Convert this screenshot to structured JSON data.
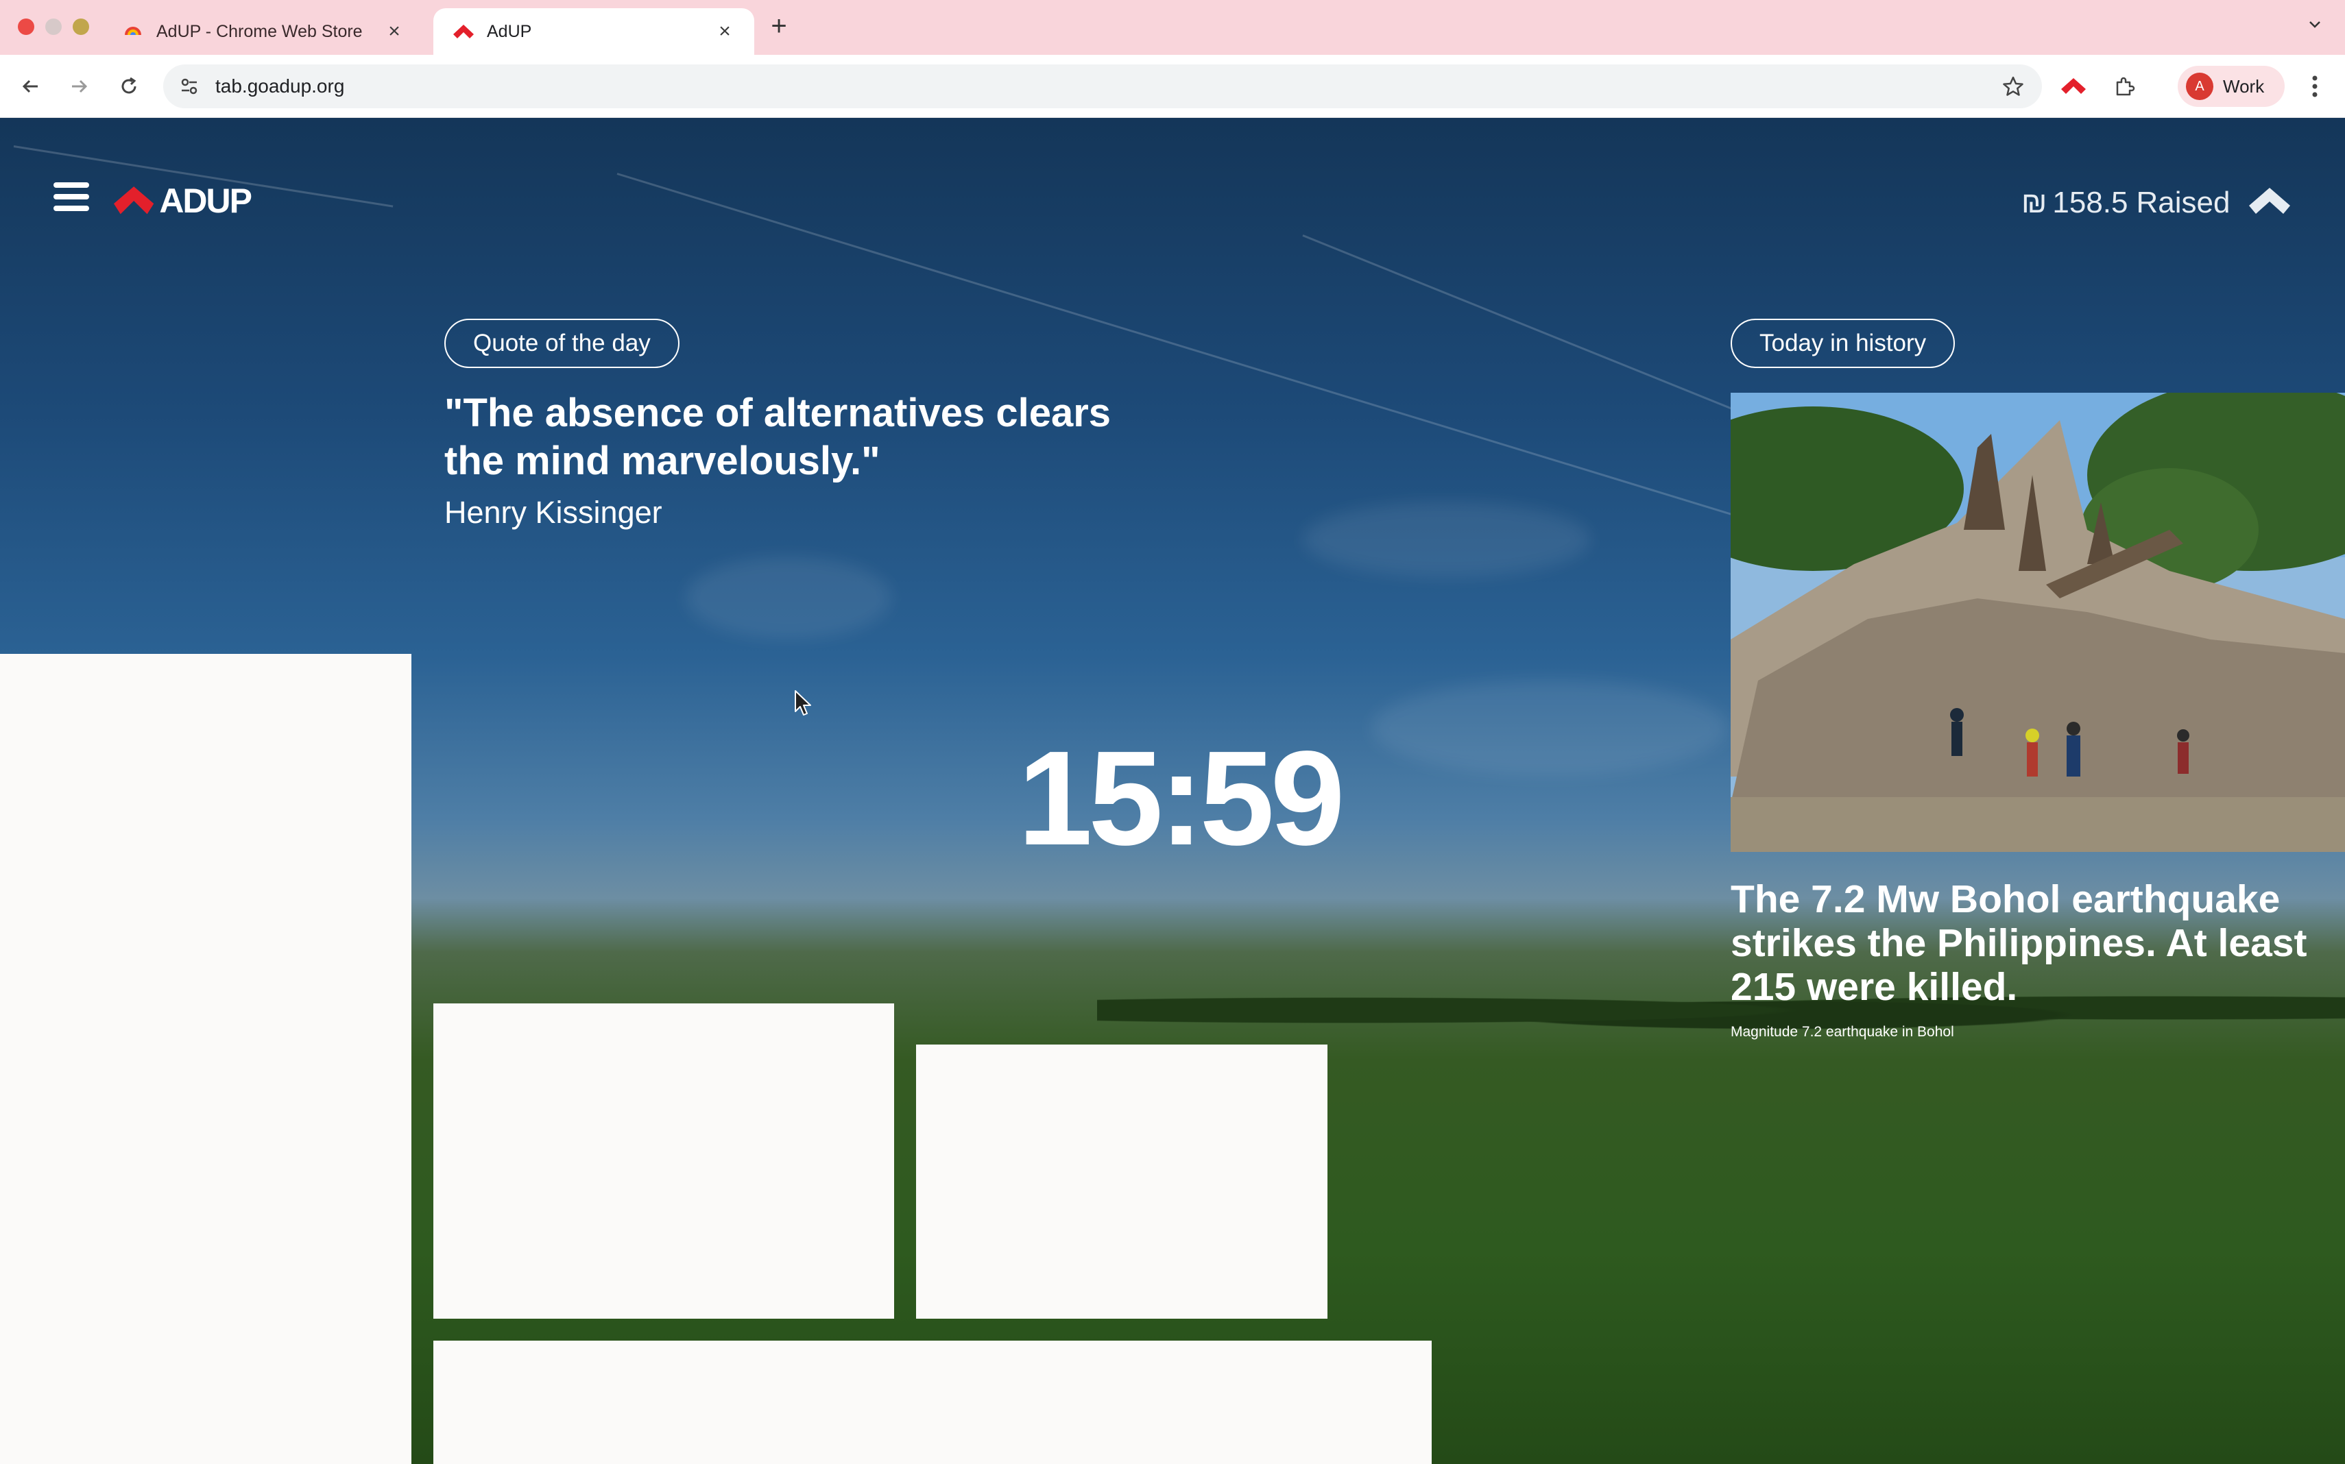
{
  "browser": {
    "tabs": [
      {
        "title": "AdUP - Chrome Web Store",
        "active": false
      },
      {
        "title": "AdUP",
        "active": true
      }
    ],
    "url": "tab.goadup.org",
    "profile": {
      "initial": "A",
      "label": "Work"
    }
  },
  "page": {
    "brand": "ADUP",
    "raised": {
      "currency": "₪",
      "amount": "158.5",
      "label": "Raised"
    },
    "quote": {
      "pill": "Quote of the day",
      "text": "\"The absence of alternatives clears the mind marvelously.\"",
      "author": "Henry Kissinger"
    },
    "clock": "15:59",
    "history": {
      "pill": "Today in history",
      "headline": "The 7.2 Mw Bohol earthquake strikes the Philippines. At least 215 were killed.",
      "caption": "Magnitude 7.2 earthquake in Bohol"
    }
  },
  "colors": {
    "tabstrip": "#f9d5db",
    "brand_red": "#e3202b",
    "sky": "#1d4a78",
    "grass": "#2e5a1f"
  }
}
